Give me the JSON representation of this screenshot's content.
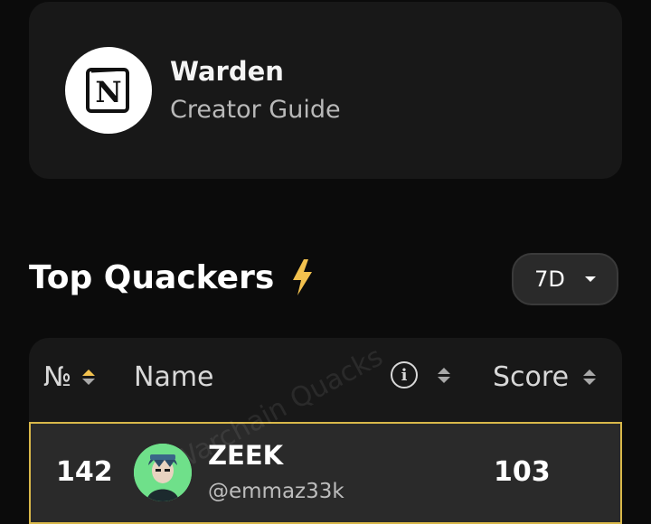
{
  "profile_card": {
    "title": "Warden",
    "subtitle": "Creator Guide",
    "logo_icon": "notion-logo-icon"
  },
  "leaderboard": {
    "title": "Top Quackers",
    "title_icon": "lightning-bolt-icon",
    "period_selector": {
      "selected": "7D"
    },
    "columns": [
      {
        "label": "№",
        "sort_icon": "sort-icon",
        "active_direction": "asc"
      },
      {
        "label": "Name"
      },
      {
        "label": "",
        "info_icon": "info-icon",
        "sort_icon": "sort-icon"
      },
      {
        "label": "Score",
        "sort_icon": "sort-icon"
      }
    ],
    "rows": [
      {
        "rank": "142",
        "name": "ZEEK",
        "handle": "@emmaz33k",
        "score": "103",
        "highlighted": true,
        "watermark": "Warchain Quacks"
      }
    ]
  },
  "colors": {
    "background": "#0b0b0b",
    "card": "#181818",
    "row": "#2a2a2a",
    "highlight_border": "#d9b84a",
    "accent": "#f2c14e",
    "avatar_bg": "#6fe08a"
  }
}
